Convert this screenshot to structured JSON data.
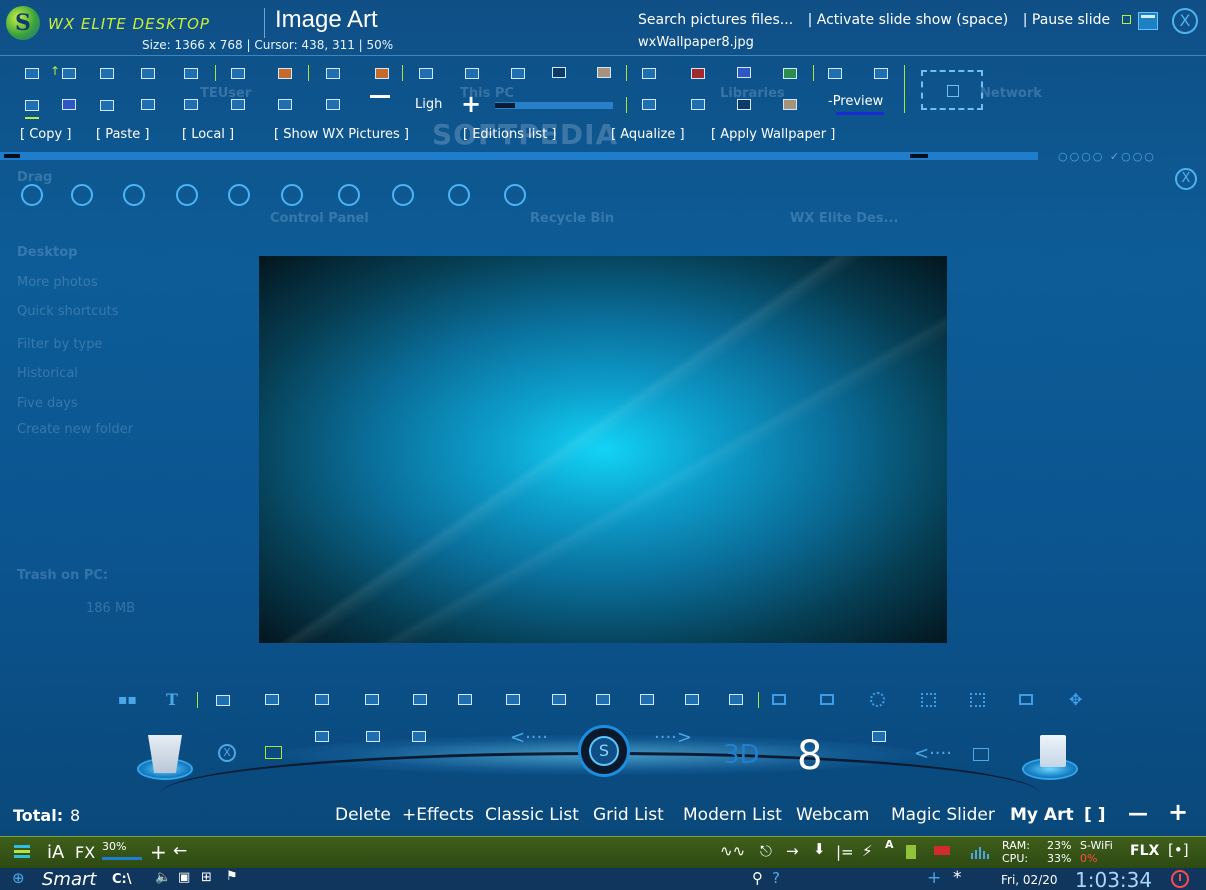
{
  "app": {
    "logo_text": "WX ELITE DESKTOP",
    "logo_letter": "S",
    "title": "Image Art",
    "size_info": "Size: 1366 x 768 | Cursor: 438, 311 | 50%",
    "file_name": "wxWallpaper8.jpg",
    "close_symbol": "X"
  },
  "top_links": {
    "search": "Search pictures files...",
    "slideshow": "| Activate slide show (space)",
    "pause": "| Pause slide"
  },
  "toolbar": {
    "light_label": "Ligh",
    "light_level_percent": 17,
    "minus_symbol": "—",
    "plus_symbol": "+",
    "preview_label": "-Preview"
  },
  "actions": [
    "[ Copy    ]",
    "[ Paste   ]",
    "[ Local   ]",
    "[ Show WX Pictures      ]",
    "[ Editions list      ]",
    "[ Aqualize    ]",
    "[  Apply Wallpaper                 ]"
  ],
  "watermark": "SOFTPEDIA",
  "ghost_desktop": {
    "icons": [
      "TEUser",
      "This PC",
      "Libraries",
      "Network",
      "Control Panel",
      "Recycle Bin",
      "WX Elite Des..."
    ],
    "side_items": [
      "Drag",
      "Desktop",
      "More photos",
      "Quick shortcuts",
      "Filter by type",
      "Historical",
      "Five days",
      "Create new folder",
      "Trash on PC:",
      "186 MB"
    ]
  },
  "dock": {
    "left_arrow": "<····",
    "right_arrow": "····>",
    "left_arrow_2": "<····",
    "label_3d": "3D",
    "count": "8",
    "s_letter": "S",
    "x_symbol": "X"
  },
  "bottom_bar": {
    "total_label": "Total:",
    "total_value": "8",
    "menu": [
      "Delete",
      "+Effects",
      "Classic List",
      "Grid List",
      "Modern List",
      "Webcam",
      "Magic Slider",
      "My Art",
      "[ ]",
      "—",
      "+"
    ]
  },
  "taskbar": {
    "ia_label": "iA",
    "fx_label": "FX",
    "fx_value": "30%",
    "plus": "+",
    "back_arrow": "←",
    "ram_label": "RAM:",
    "cpu_label": "CPU:",
    "ram_value": "23%",
    "cpu_value": "33%",
    "wifi_label": "S-WiFi",
    "wifi_value": "0%",
    "flx_label": "FLX",
    "bracket_dot": "[•]",
    "separator": "|=",
    "letter_a": "A"
  },
  "tray": {
    "smart_label": "Smart",
    "drive_label": "C:\\",
    "date": "Fri, 02/20",
    "time": "1:03:34",
    "plus": "+",
    "asterisk": "*",
    "question": "?"
  },
  "colors": {
    "accent_lime": "#b6f03b",
    "accent_blue": "#4fb2f0",
    "taskbar_green": "#3f5f1c",
    "alert_red": "#d22b2b"
  }
}
